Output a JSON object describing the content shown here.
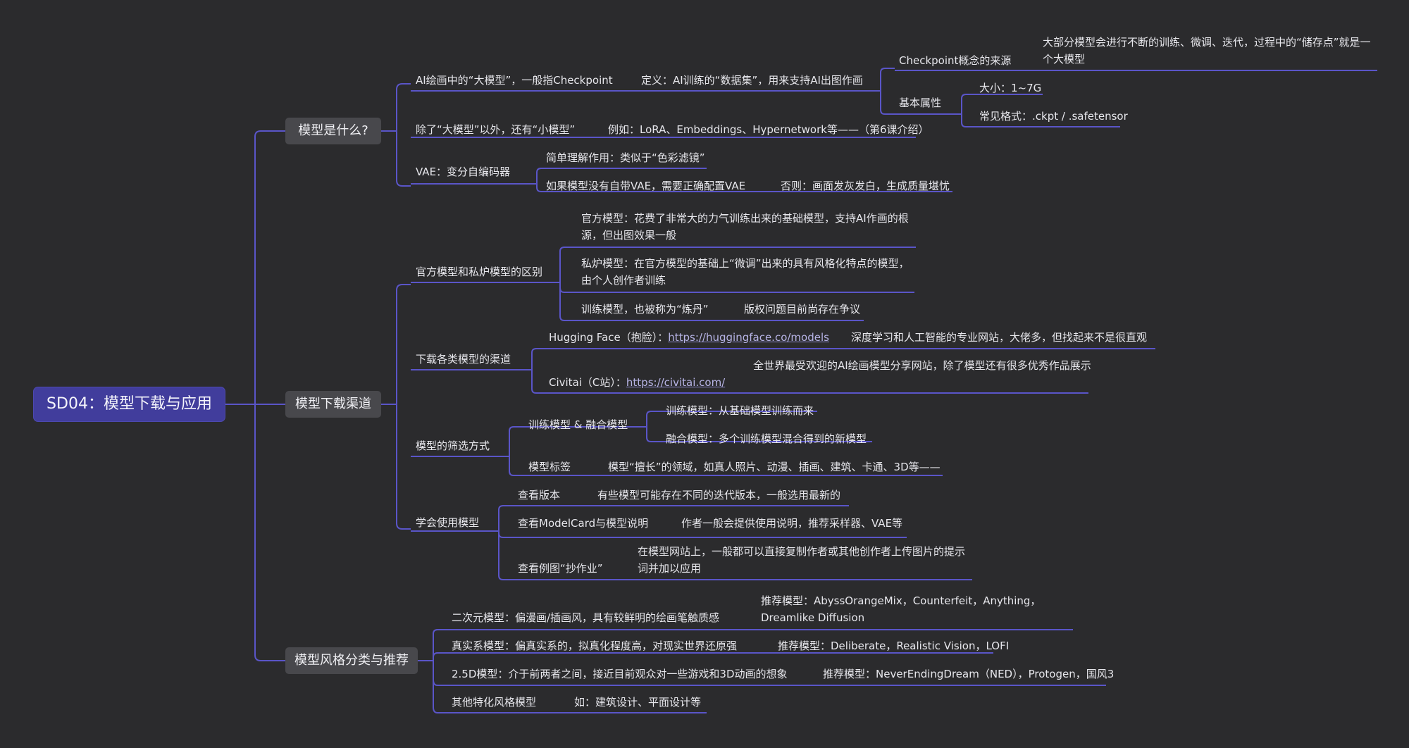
{
  "root": "SD04：模型下载与应用",
  "b1": {
    "title": "模型是什么?",
    "n1": "AI绘画中的“大模型”，一般指Checkpoint",
    "n1a": "定义：AI训练的“数据集”，用来支持AI出图作画",
    "n1a_src": "Checkpoint概念的来源",
    "n1a_src_desc": "大部分模型会进行不断的训练、微调、迭代，过程中的“储存点”就是一个大模型",
    "n1a_attr": "基本属性",
    "n1a_size": "大小：1~7G",
    "n1a_fmt": "常见格式：.ckpt / .safetensor",
    "n2": "除了“大模型”以外，还有“小模型”",
    "n2a": "例如：LoRA、Embeddings、Hypernetwork等——（第6课介绍）",
    "n3": "VAE：变分自编码器",
    "n3a": "简单理解作用：类似于“色彩滤镜”",
    "n3b": "如果模型没有自带VAE，需要正确配置VAE",
    "n3b1": "否则：画面发灰发白，生成质量堪忧"
  },
  "b2": {
    "title": "模型下载渠道",
    "n1": "官方模型和私炉模型的区别",
    "n1a": "官方模型：花费了非常大的力气训练出来的基础模型，支持AI作画的根源，但出图效果一般",
    "n1b": "私炉模型：在官方模型的基础上“微调”出来的具有风格化特点的模型，由个人创作者训练",
    "n1c": "训练模型，也被称为“炼丹”",
    "n1c1": "版权问题目前尚存在争议",
    "n2": "下载各类模型的渠道",
    "hf_label": "Hugging Face（抱脸）：",
    "hf_link": "https://huggingface.co/models",
    "hf_desc": "深度学习和人工智能的专业网站，大佬多，但找起来不是很直观",
    "cv_label": "Civitai（C站）：",
    "cv_link": "https://civitai.com/",
    "cv_desc": "全世界最受欢迎的AI绘画模型分享网站，除了模型还有很多优秀作品展示",
    "n3": "模型的筛选方式",
    "n3a": "训练模型 & 融合模型",
    "n3a1": "训练模型：从基础模型训练而来",
    "n3a2": "融合模型：多个训练模型混合得到的新模型",
    "n3b": "模型标签",
    "n3b1": "模型“擅长”的领域，如真人照片、动漫、插画、建筑、卡通、3D等——",
    "n4": "学会使用模型",
    "n4a": "查看版本",
    "n4a1": "有些模型可能存在不同的迭代版本，一般选用最新的",
    "n4b": "查看ModelCard与模型说明",
    "n4b1": "作者一般会提供使用说明，推荐采样器、VAE等",
    "n4c": "查看例图“抄作业”",
    "n4c1": "在模型网站上，一般都可以直接复制作者或其他创作者上传图片的提示词并加以应用"
  },
  "b3": {
    "title": "模型风格分类与推荐",
    "n1": "二次元模型：偏漫画/插画风，具有较鲜明的绘画笔触质感",
    "n1a": "推荐模型：AbyssOrangeMix，Counterfeit，Anything，Dreamlike Diffusion",
    "n2": "真实系模型：偏真实系的，拟真化程度高，对现实世界还原强",
    "n2a": "推荐模型：Deliberate，Realistic Vision，LOFI",
    "n3": "2.5D模型：介于前两者之间，接近目前观众对一些游戏和3D动画的想象",
    "n3a": "推荐模型：NeverEndingDream（NED），Protogen，国风3",
    "n4": "其他特化风格模型",
    "n4a": "如：建筑设计、平面设计等"
  },
  "colors": {
    "background": "#2b2b2d",
    "root": "#413d9c",
    "branch_box": "#48484c",
    "edge": "#5a55c8"
  }
}
